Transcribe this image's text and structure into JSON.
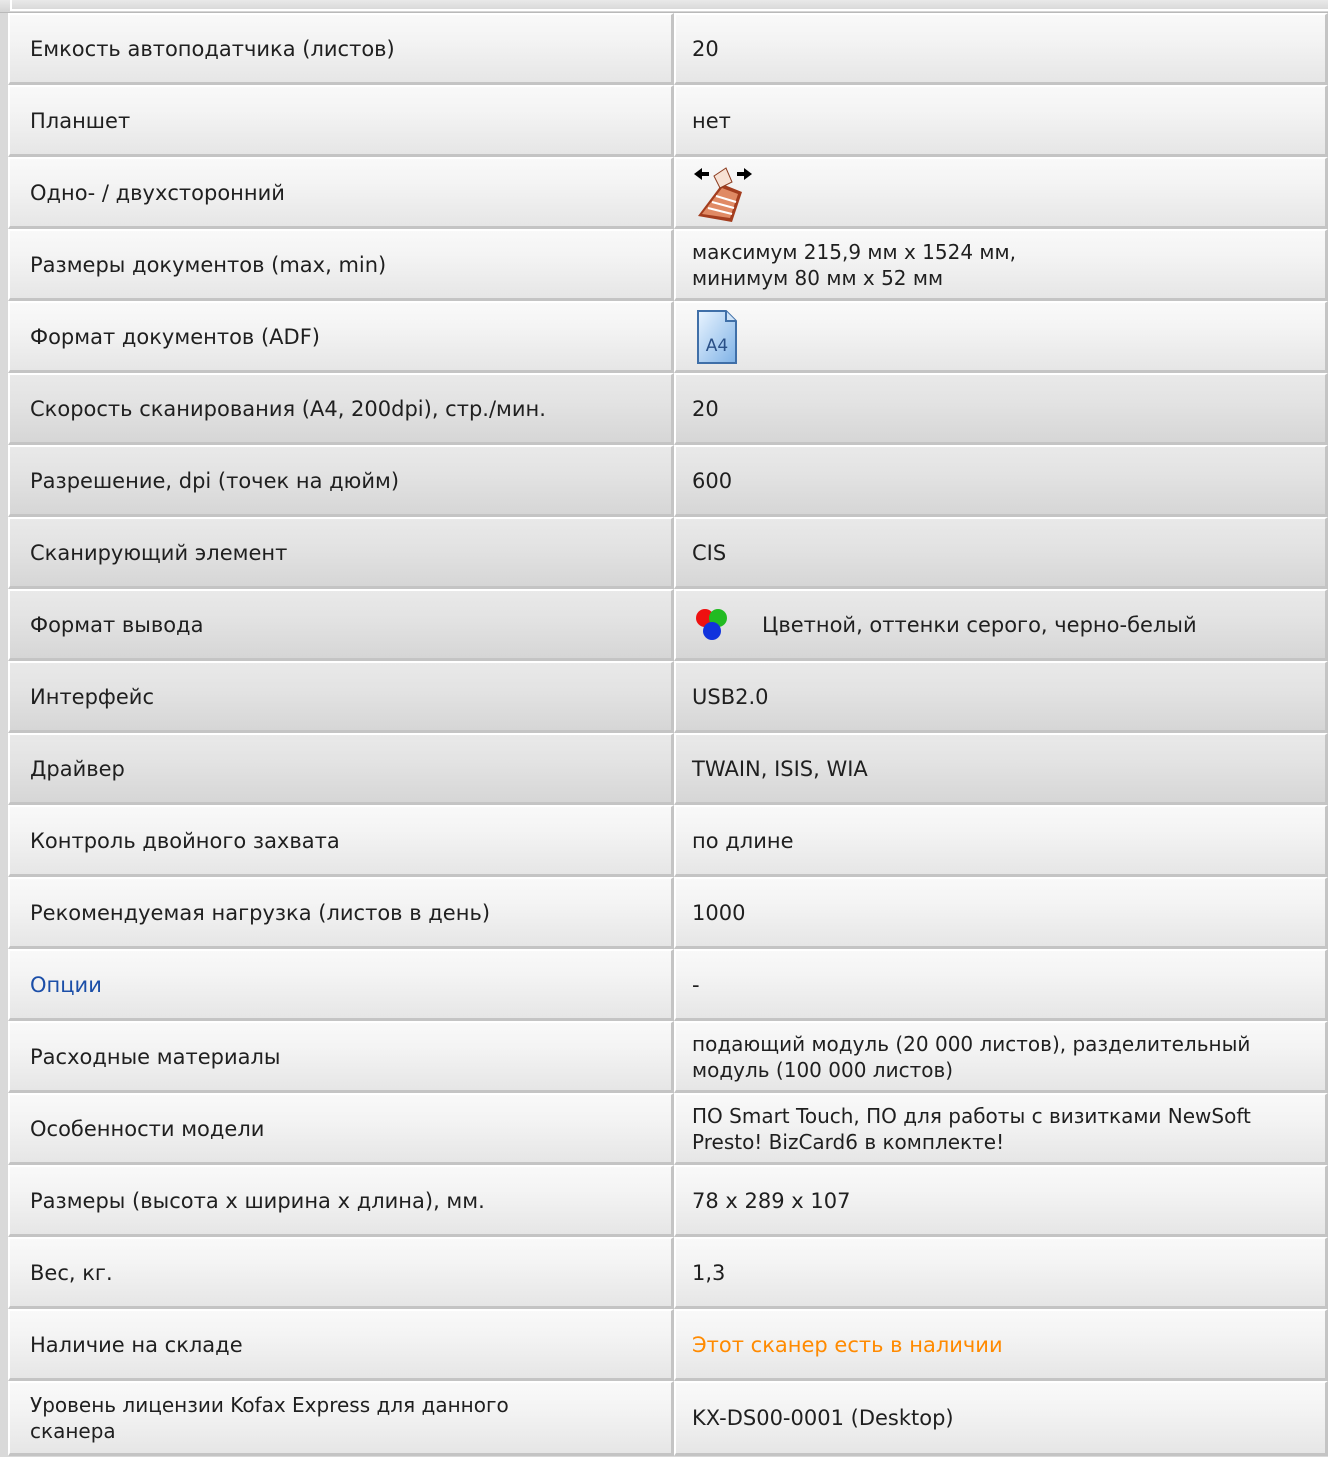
{
  "rows": [
    {
      "label": "Емкость автоподатчика (листов)",
      "value": "20"
    },
    {
      "label": "Планшет",
      "value": "нет"
    },
    {
      "label": "Одно- / двухсторонний",
      "value": "",
      "icon": "duplex-scan-icon"
    },
    {
      "label": "Размеры документов (max, min)",
      "value_lines": [
        "максимум 215,9 мм x 1524 мм,",
        "минимум 80 мм x 52 мм"
      ]
    },
    {
      "label": "Формат документов (ADF)",
      "value": "",
      "icon": "a4-document-icon",
      "icon_text": "A4"
    },
    {
      "label": "Скорость сканирования (A4, 200dpi), стр./мин.",
      "value": "20"
    },
    {
      "label": "Разрешение, dpi (точек на дюйм)",
      "value": "600"
    },
    {
      "label": "Сканирующий элемент",
      "value": "CIS"
    },
    {
      "label": "Формат вывода",
      "value": "Цветной, оттенки серого, черно-белый",
      "icon": "rgb-color-icon"
    },
    {
      "label": "Интерфейс",
      "value": "USB2.0"
    },
    {
      "label": "Драйвер",
      "value": "TWAIN, ISIS, WIA"
    },
    {
      "label": "Контроль двойного захвата",
      "value": "по длине"
    },
    {
      "label": "Рекомендуемая нагрузка (листов в день)",
      "value": "1000"
    },
    {
      "label": "Опции",
      "value": "-",
      "label_is_link": true
    },
    {
      "label": "Расходные материалы",
      "value_lines": [
        "подающий модуль (20 000 листов), разделительный",
        "модуль (100 000 листов)"
      ]
    },
    {
      "label": "Особенности модели",
      "value_lines": [
        "ПО Smart Touch, ПО для работы с визитками NewSoft",
        "Presto! BizCard6 в комплекте!"
      ]
    },
    {
      "label": "Размеры (высота x ширина x длина), мм.",
      "value": "78 x 289 x 107"
    },
    {
      "label": "Вес, кг.",
      "value": "1,3"
    },
    {
      "label": "Наличие на складе",
      "value": "Этот сканер есть в наличии"
    },
    {
      "label_lines": [
        "Уровень лицензии Kofax Express для данного",
        "сканера"
      ],
      "value": "KX-DS00-0001 (Desktop)"
    }
  ],
  "colors": {
    "link": "#1b4ea8",
    "availability": "#ff8a00"
  }
}
